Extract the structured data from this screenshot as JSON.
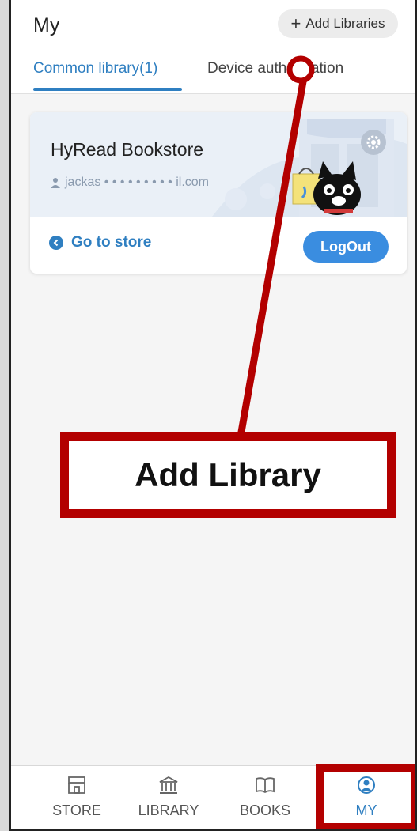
{
  "header": {
    "title": "My",
    "add_button_label": "Add Libraries",
    "tabs": [
      {
        "label": "Common library(1)",
        "active": true
      },
      {
        "label": "Device authorization",
        "active": false
      }
    ]
  },
  "library_card": {
    "name": "HyRead Bookstore",
    "user": "jackas • • • • • • • • • il.com",
    "go_to_store": "Go to store",
    "logout": "LogOut"
  },
  "annotation": {
    "label": "Add Library",
    "color": "#b30000"
  },
  "bottom_nav": {
    "items": [
      {
        "label": "STORE",
        "icon": "store-icon",
        "active": false
      },
      {
        "label": "LIBRARY",
        "icon": "library-icon",
        "active": false
      },
      {
        "label": "BOOKS",
        "icon": "book-icon",
        "active": false
      },
      {
        "label": "MY",
        "icon": "person-circle-icon",
        "active": true
      }
    ]
  },
  "colors": {
    "accent": "#2f7fc1",
    "logout_button": "#3a8de0"
  }
}
